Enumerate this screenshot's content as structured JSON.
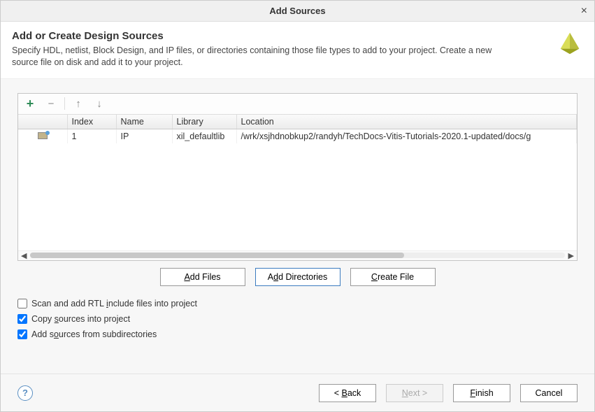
{
  "window": {
    "title": "Add Sources"
  },
  "header": {
    "heading": "Add or Create Design Sources",
    "description": "Specify HDL, netlist, Block Design, and IP files, or directories containing those file types to add to your project. Create a new source file on disk and add it to your project."
  },
  "toolbar": {
    "add": "+",
    "remove": "−",
    "up": "↑",
    "down": "↓"
  },
  "table": {
    "columns": {
      "index": "Index",
      "name": "Name",
      "library": "Library",
      "location": "Location"
    },
    "rows": [
      {
        "index": "1",
        "name": "IP",
        "library": "xil_defaultlib",
        "location": "/wrk/xsjhdnobkup2/randyh/TechDocs-Vitis-Tutorials-2020.1-updated/docs/g"
      }
    ]
  },
  "buttons": {
    "add_files": "Add Files",
    "add_dirs": "Add Directories",
    "create_file": "Create File"
  },
  "checks": {
    "scan_rtl": {
      "label": "Scan and add RTL include files into project",
      "checked": false
    },
    "copy_src": {
      "label": "Copy sources into project",
      "checked": true
    },
    "subdirs": {
      "label": "Add sources from subdirectories",
      "checked": true
    }
  },
  "footer": {
    "help": "?",
    "back": "< Back",
    "next": "Next >",
    "finish": "Finish",
    "cancel": "Cancel"
  }
}
